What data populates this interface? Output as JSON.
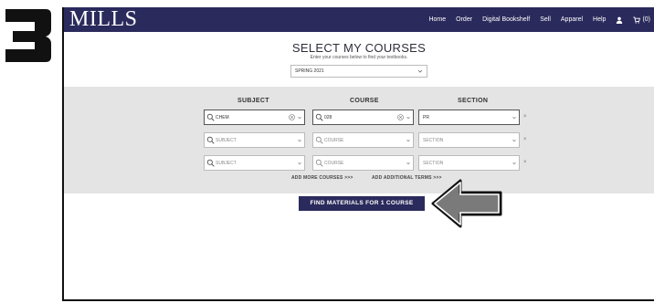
{
  "step": "3",
  "header": {
    "logo": "MILLS",
    "nav": [
      {
        "label": "Home"
      },
      {
        "label": "Order"
      },
      {
        "label": "Digital Bookshelf"
      },
      {
        "label": "Sell"
      },
      {
        "label": "Apparel"
      },
      {
        "label": "Help"
      }
    ],
    "cart_count": "(0)"
  },
  "page": {
    "title": "SELECT MY COURSES",
    "subtitle": "Enter your courses below to find your textbooks.",
    "term": "SPRING 2021"
  },
  "columns": {
    "subject": "SUBJECT",
    "course": "COURSE",
    "section": "SECTION"
  },
  "rows": [
    {
      "subject": "CHEM",
      "course": "028",
      "section": "PR"
    },
    {
      "subject_placeholder": "SUBJECT",
      "course_placeholder": "COURSE",
      "section_placeholder": "SECTION"
    },
    {
      "subject_placeholder": "SUBJECT",
      "course_placeholder": "COURSE",
      "section_placeholder": "SECTION"
    }
  ],
  "remove_label": "×",
  "links": {
    "add_courses": "ADD MORE COURSES >>>",
    "add_terms": "ADD ADDITIONAL TERMS >>>"
  },
  "find_button": "FIND MATERIALS FOR 1 COURSE",
  "colors": {
    "brand": "#2b2a5c",
    "panel": "#e4e4e4",
    "arrow": "#7a7a7a"
  }
}
